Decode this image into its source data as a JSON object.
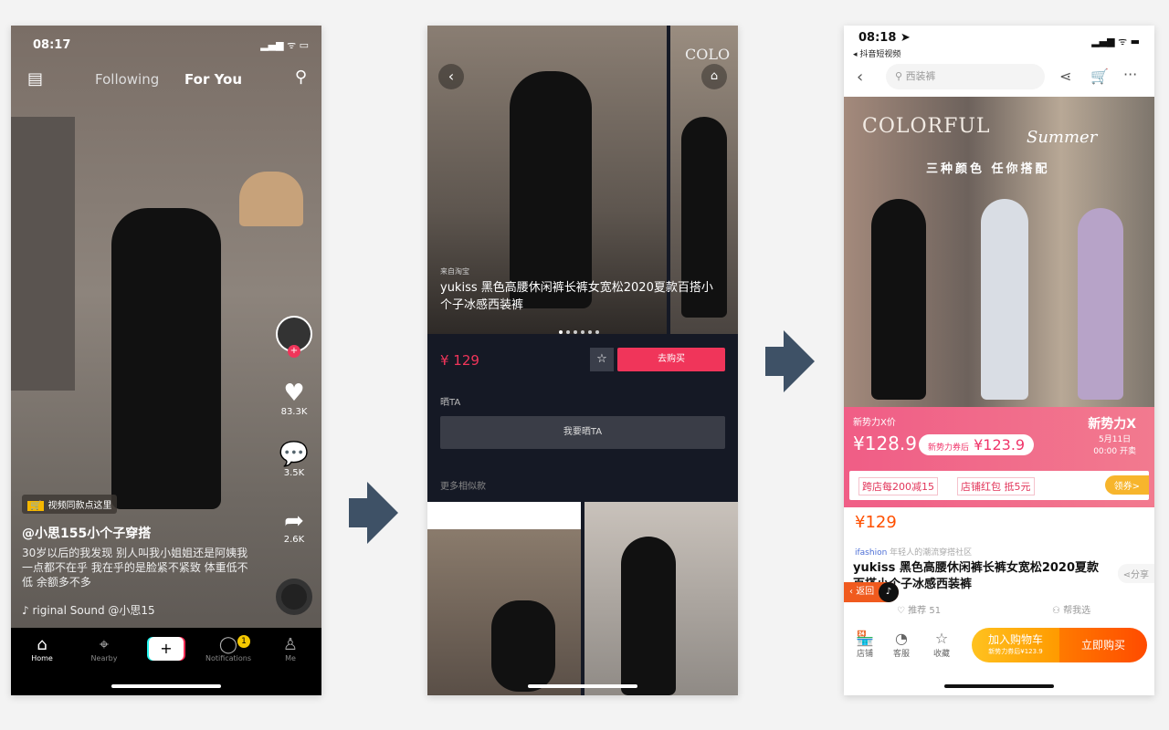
{
  "phone1": {
    "time": "08:17",
    "tabs": [
      "Following",
      "For You"
    ],
    "shop_tag": "视频同款点这里",
    "username": "@小思155小个子穿搭",
    "caption": "30岁以后的我发现 别人叫我小姐姐还是阿姨我一点都不在乎 我在乎的是脸紧不紧致 体重低不低 余额多不多",
    "sound": "riginal Sound   @小思15",
    "likes": "83.3K",
    "comments": "3.5K",
    "shares": "2.6K",
    "nav": [
      {
        "label": "Home",
        "icon": "home-icon"
      },
      {
        "label": "Nearby",
        "icon": "location-icon"
      },
      {
        "label": "+",
        "icon": "plus-icon"
      },
      {
        "label": "Notifications",
        "icon": "message-icon",
        "badge": "1"
      },
      {
        "label": "Me",
        "icon": "person-icon"
      }
    ]
  },
  "phone2": {
    "store_text": "COLO",
    "source": "来自淘宝",
    "product_title": "yukiss 黑色高腰休闲裤长裤女宽松2020夏款百搭小个子冰感西装裤",
    "price": "¥ 129",
    "buy_label": "去购买",
    "section_show": "晒TA",
    "show_button": "我要晒TA",
    "section_more": "更多相似款",
    "accent": "#f0355a"
  },
  "phone3": {
    "time": "08:18",
    "back_app": "◂ 抖音短视频",
    "search_placeholder": "西装裤",
    "banner_title": "COLORFUL",
    "banner_script": "Summer",
    "banner_sub": "三种颜色 任你搭配",
    "promo_label": "新势力X价",
    "promo_price": "¥128.9",
    "coupon_price_label": "新势力券后",
    "coupon_price": "¥123.9",
    "promo_brand": "新势力X",
    "promo_date": "5月11日",
    "promo_time": "00:00 开卖",
    "coupons": [
      "跨店每200减15",
      "店铺红包 抵5元"
    ],
    "coupon_button": "领券>",
    "price": "¥129",
    "brand": "ifashion",
    "brand_slogan": "年轻人的潮流穿搭社区",
    "product_title": "yukiss 黑色高腰休闲裤长裤女宽松2020夏款百搭小个子冰感西装裤",
    "share": "分享",
    "return_label": "返回",
    "recommend": "推荐 51",
    "help_choose": "帮我选",
    "bottom": [
      {
        "label": "店铺",
        "icon": "shop-icon"
      },
      {
        "label": "客服",
        "icon": "service-icon"
      },
      {
        "label": "收藏",
        "icon": "star-icon"
      }
    ],
    "cart_button": "加入购物车",
    "cart_sub": "新势力券后¥123.9",
    "buy_now": "立即购买",
    "accent": "#ff5000"
  },
  "arrow_color": "#3e5166"
}
